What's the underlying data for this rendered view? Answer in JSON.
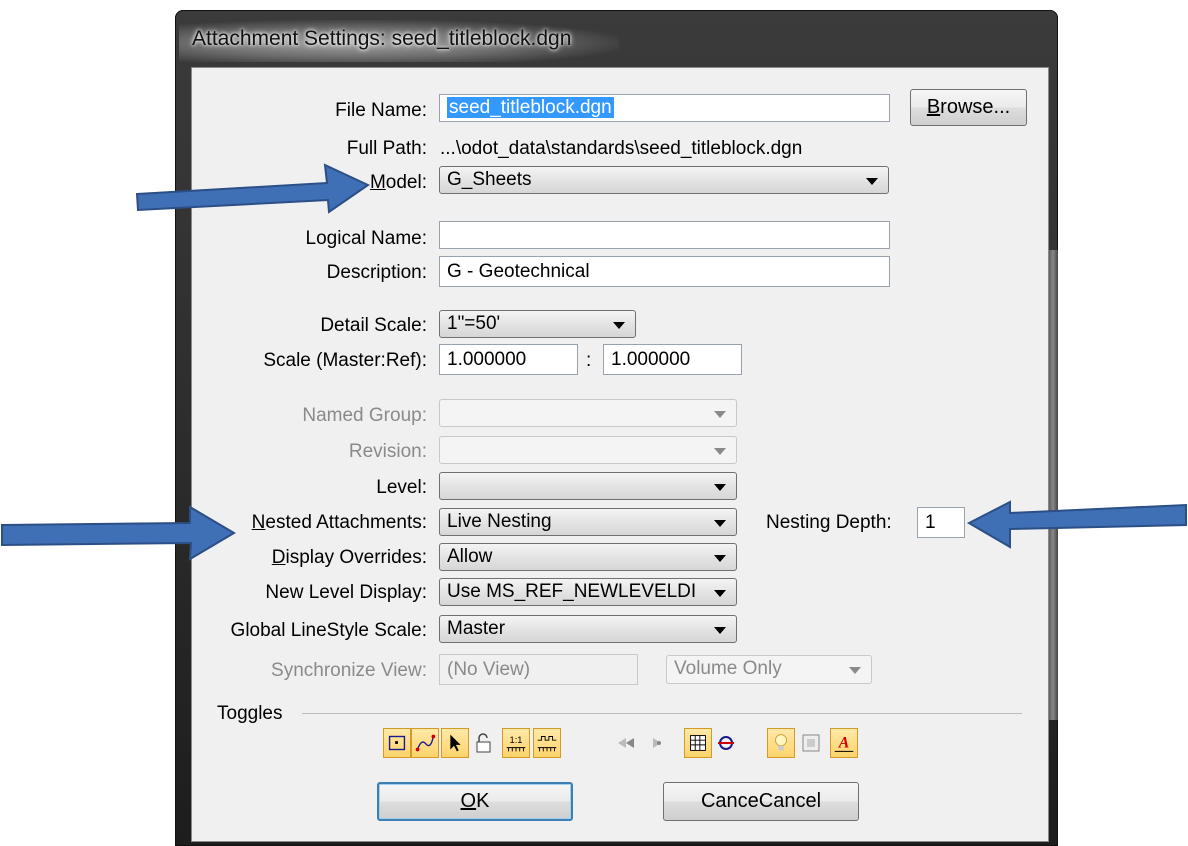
{
  "window": {
    "title": "Attachment Settings: seed_titleblock.dgn"
  },
  "labels": {
    "file_name": "File Name:",
    "full_path": "Full Path:",
    "model": "Model:",
    "logical_name": "Logical Name:",
    "description": "Description:",
    "detail_scale": "Detail Scale:",
    "scale": "Scale (Master:Ref):",
    "named_group": "Named Group:",
    "revision": "Revision:",
    "level": "Level:",
    "nested_attachments": "Nested Attachments:",
    "nesting_depth": "Nesting Depth:",
    "display_overrides": "Display Overrides:",
    "new_level_display": "New Level Display:",
    "global_linestyle_scale": "Global LineStyle Scale:",
    "synchronize_view": "Synchronize View:",
    "toggles": "Toggles",
    "scale_sep": ":"
  },
  "fields": {
    "file_name": "seed_titleblock.dgn",
    "full_path": "...\\odot_data\\standards\\seed_titleblock.dgn",
    "model": "G_Sheets",
    "logical_name": "",
    "description": "G - Geotechnical",
    "detail_scale": "1\"=50'",
    "scale_master": "1.000000",
    "scale_ref": "1.000000",
    "named_group": "",
    "revision": "",
    "level": "",
    "nested_attachments": "Live Nesting",
    "nesting_depth": "1",
    "display_overrides": "Allow",
    "new_level_display": "Use MS_REF_NEWLEVELDI",
    "global_linestyle_scale": "Master",
    "synchronize_view": "(No View)",
    "sync_mode": "Volume Only"
  },
  "buttons": {
    "browse": "Browse...",
    "ok": "OK",
    "cancel": "Cancel"
  },
  "toggles": [
    {
      "icon": "display-icon",
      "on": true
    },
    {
      "icon": "snap-icon",
      "on": true
    },
    {
      "icon": "locate-icon",
      "on": true
    },
    {
      "icon": "lock-icon",
      "on": false
    },
    {
      "icon": "true-scale-icon",
      "on": true
    },
    {
      "icon": "scale-linestyles-icon",
      "on": true
    },
    {
      "icon": "georeference-icon",
      "on": false
    },
    {
      "icon": "reverse-georeference-icon",
      "on": false
    },
    {
      "icon": "raster-grid-icon",
      "on": true
    },
    {
      "icon": "clip-mask-icon",
      "on": false
    },
    {
      "icon": "light-bulb-icon",
      "on": true
    },
    {
      "icon": "raster-icon",
      "on": false
    },
    {
      "icon": "annotation-icon",
      "on": true
    }
  ],
  "colors": {
    "accent": "#3399ff",
    "annotation_arrow": "#3f6fb4"
  }
}
